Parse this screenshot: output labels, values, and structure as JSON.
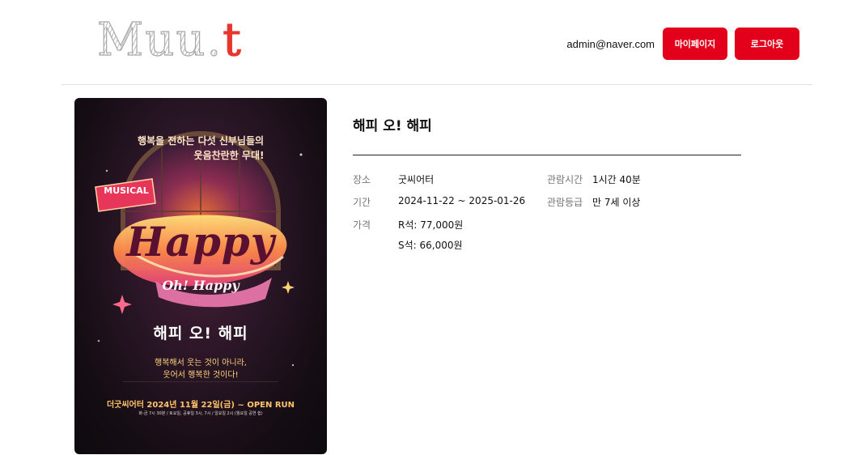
{
  "header": {
    "logo_main": "Muu.",
    "logo_accent": "t",
    "user_email": "admin@naver.com",
    "mypage_label": "마이페이지",
    "logout_label": "로그아웃"
  },
  "poster": {
    "tagline1": "행복을 전하는 다섯 신부님들의",
    "tagline2": "웃음찬란한 무대!",
    "badge": "MUSICAL",
    "title_art": "Happy",
    "subtitle_art": "Oh! Happy",
    "korean_title": "해피 오! 해피",
    "quote1": "행복해서 웃는 것이 아니라,",
    "quote2": "웃어서 행복한 것이다!",
    "run_info": "더굿씨어터 2024년 11월 22일(금) ~ OPEN RUN",
    "schedule": "화-금 7시 30분 / 토요일, 공휴일 3시, 7시 / 일요일 2시 (월요일 공연 쉼)"
  },
  "show": {
    "title": "해피 오! 해피",
    "venue_label": "장소",
    "venue": "굿씨어터",
    "runtime_label": "관람시간",
    "runtime": "1시간 40분",
    "period_label": "기간",
    "period": "2024-11-22 ~ 2025-01-26",
    "rating_label": "관람등급",
    "rating": "만 7세 이상",
    "price_label": "가격",
    "prices": [
      "R석: 77,000원",
      "S석: 66,000원"
    ]
  },
  "colors": {
    "brand_red": "#e3001b",
    "logo_accent": "#e8362f"
  }
}
